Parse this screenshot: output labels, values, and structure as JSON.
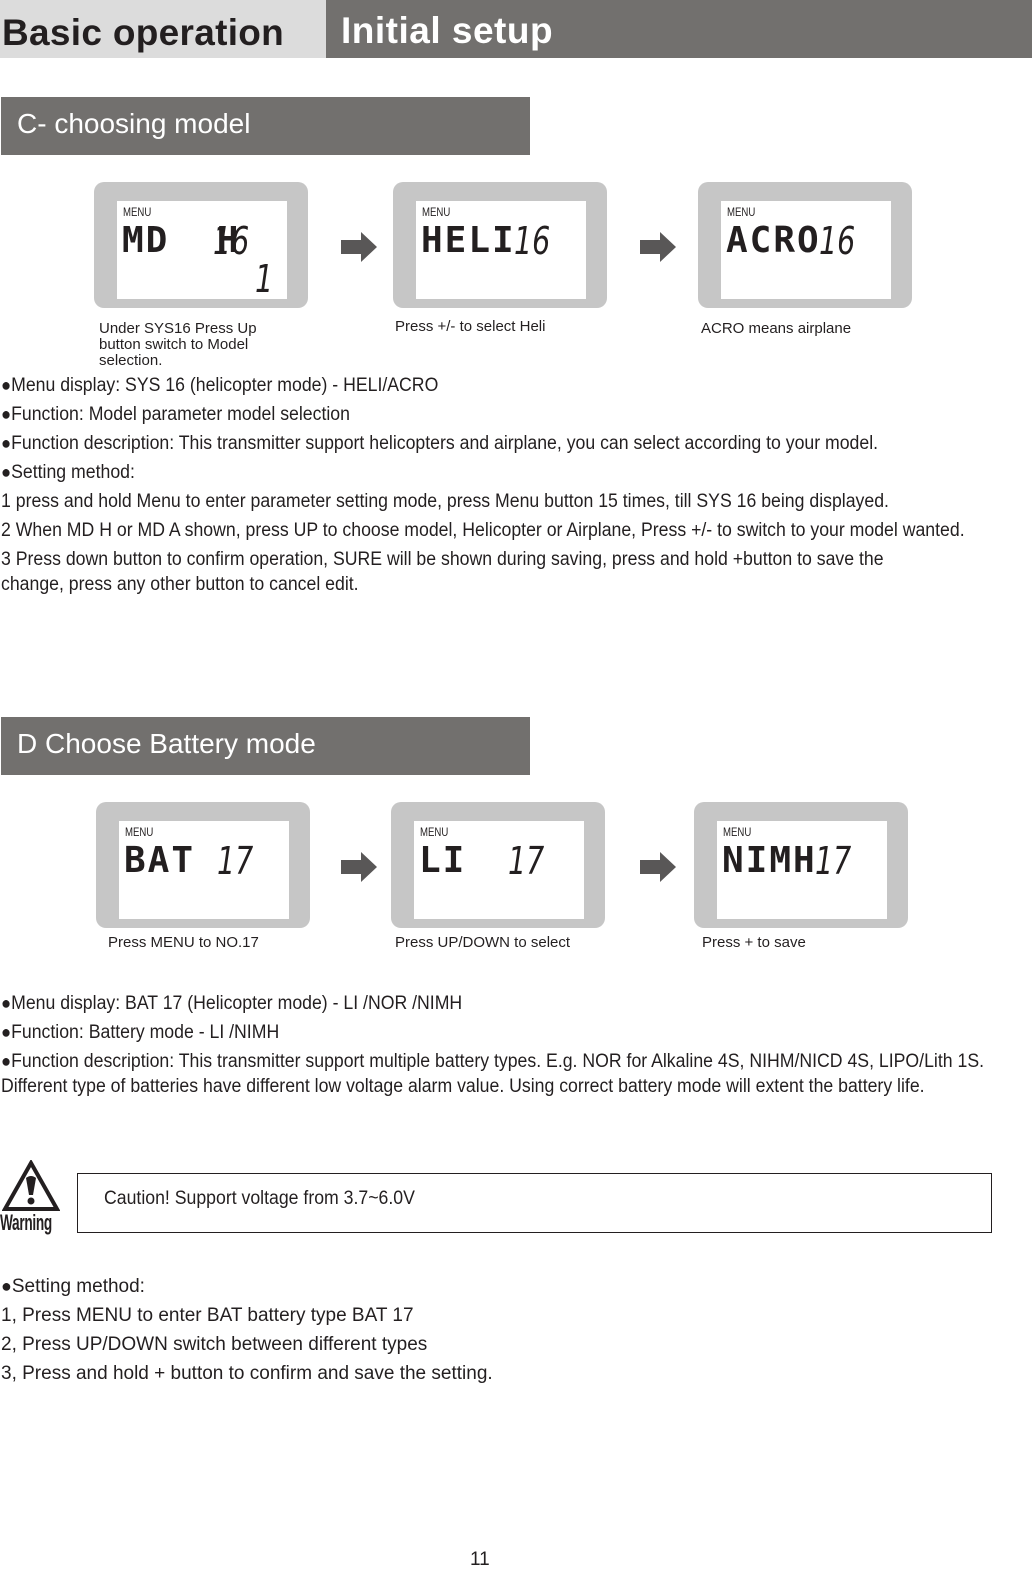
{
  "header": {
    "left_title": "Basic operation",
    "right_title": "Initial setup"
  },
  "section_c": {
    "title": "C- choosing model",
    "screens": [
      {
        "menu_label": "MENU",
        "segment_text": "MD  H",
        "segment_number": "16",
        "sub_value": "1",
        "caption": "Under SYS16 Press Up button switch to Model selection."
      },
      {
        "menu_label": "MENU",
        "segment_text": "HELI",
        "segment_number": "16",
        "sub_value": "",
        "caption": "Press +/- to select Heli"
      },
      {
        "menu_label": "MENU",
        "segment_text": "ACRO",
        "segment_number": "16",
        "sub_value": "",
        "caption": "ACRO means airplane"
      }
    ],
    "arrow_icon": "right-arrow-icon",
    "bullets": [
      "Menu display: SYS 16 (helicopter mode) - HELI/ACRO",
      "Function: Model parameter  model selection",
      "Function description: This transmitter support helicopters and airplane, you can select according to your model.",
      "Setting method:"
    ],
    "steps": [
      "1 press and hold Menu to enter parameter setting mode, press Menu button 15 times, till SYS 16 being displayed.",
      "2 When MD H or MD A shown, press UP to choose model, Helicopter or Airplane, Press +/- to switch to your model wanted.",
      "3 Press down button to confirm operation, SURE will be shown during saving, press and hold +button to save the change, press any other button to cancel edit."
    ]
  },
  "section_d": {
    "title": "D Choose Battery mode",
    "screens": [
      {
        "menu_label": "MENU",
        "segment_text": "BAT",
        "segment_number": "17",
        "caption": "Press MENU to NO.17"
      },
      {
        "menu_label": "MENU",
        "segment_text": "LI",
        "segment_number": "17",
        "caption": "Press UP/DOWN to select"
      },
      {
        "menu_label": "MENU",
        "segment_text": "NIMH",
        "segment_number": "17",
        "caption": "Press + to save"
      }
    ],
    "bullets": [
      "Menu display: BAT 17 (Helicopter mode) - LI /NOR /NIMH",
      "Function: Battery mode  - LI /NIMH",
      "Function description: This transmitter support multiple battery types. E.g. NOR for Alkaline 4S, NIHM/NICD 4S, LIPO/Lith 1S. Different type of batteries have different low voltage alarm value. Using correct battery mode will extent the battery life."
    ],
    "warning": {
      "icon": "warning-triangle-icon",
      "label": "Warning",
      "caution_text": "Caution! Support voltage from 3.7~6.0V"
    },
    "setting_heading": "Setting method:",
    "steps": [
      "1, Press MENU to enter BAT battery type BAT 17",
      "2, Press UP/DOWN switch between different types",
      "3, Press and hold + button to confirm and save the setting."
    ]
  },
  "bullet_glyph": "●",
  "page_number": "11",
  "colors": {
    "header_light": "#dcdcdc",
    "header_dark": "#72706e",
    "lcd_bezel": "#c6c6c6",
    "arrow": "#595757",
    "text": "#231f20"
  }
}
